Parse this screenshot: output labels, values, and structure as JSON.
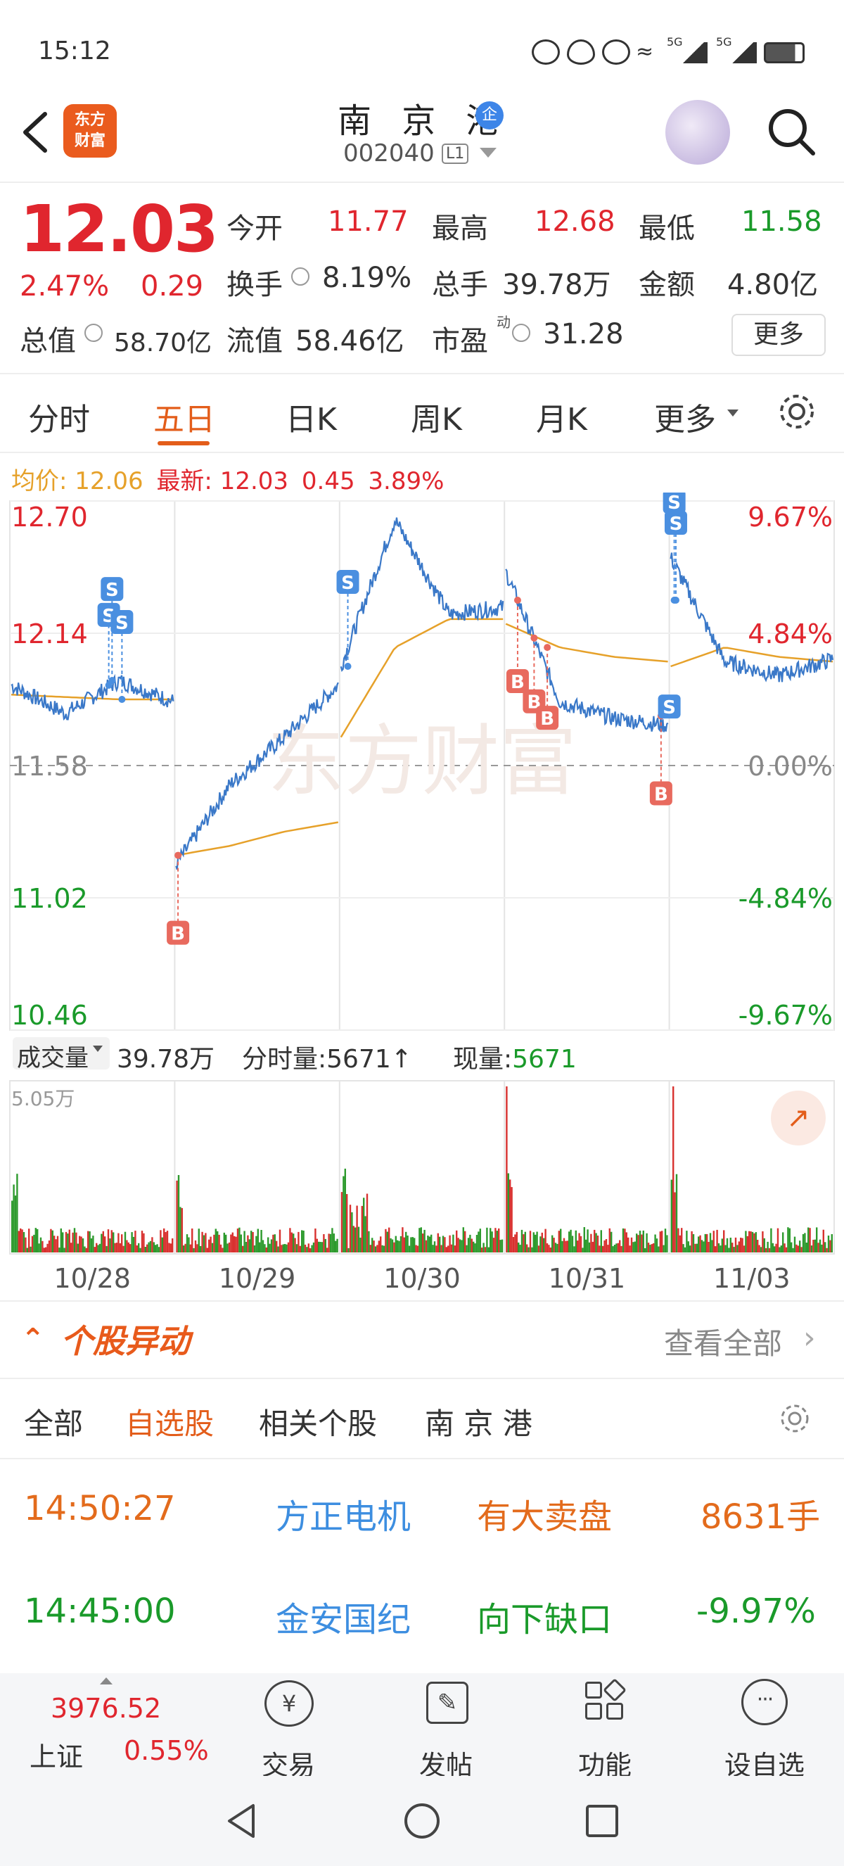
{
  "status_bar": {
    "time": "15:12",
    "signal1": "5G",
    "signal2": "5G"
  },
  "header": {
    "stock_name": "南 京 港",
    "badge": "企",
    "code": "002040",
    "level": "L1",
    "logo_line1": "东方",
    "logo_line2": "财富"
  },
  "quote": {
    "price": "12.03",
    "change_pct": "2.47%",
    "change": "0.29",
    "open_label": "今开",
    "open": "11.77",
    "high_label": "最高",
    "high": "12.68",
    "low_label": "最低",
    "low": "11.58",
    "turnover_label": "换手",
    "turnover": "8.19%",
    "volume_label": "总手",
    "volume": "39.78万",
    "amount_label": "金额",
    "amount": "4.80亿",
    "mcap_label": "总值",
    "mcap": "58.70亿",
    "float_label": "流值",
    "float": "58.46亿",
    "pe_label": "市盈",
    "pe_sup": "动",
    "pe": "31.28",
    "more": "更多"
  },
  "tabs": [
    "分时",
    "五日",
    "日K",
    "周K",
    "月K",
    "更多"
  ],
  "chart_info": {
    "avg_label": "均价:",
    "avg": "12.06",
    "latest_label": "最新:",
    "latest": "12.03",
    "chg": "0.45",
    "chg_pct": "3.89%"
  },
  "chart_data": {
    "type": "line",
    "x": [
      "10/28",
      "10/29",
      "10/30",
      "10/31",
      "11/03"
    ],
    "y_labels_left": [
      "12.70",
      "12.14",
      "11.58",
      "11.02",
      "10.46"
    ],
    "y_labels_right": [
      "9.67%",
      "4.84%",
      "0.00%",
      "-4.84%",
      "-9.67%"
    ],
    "ylim": [
      10.46,
      12.7
    ],
    "series": [
      {
        "name": "均价",
        "values_by_day": [
          [
            11.88,
            11.87,
            11.86,
            11.86
          ],
          [
            11.2,
            11.24,
            11.3,
            11.34
          ],
          [
            11.7,
            12.08,
            12.2,
            12.2
          ],
          [
            12.18,
            12.08,
            12.04,
            12.02
          ],
          [
            12.0,
            12.08,
            12.04,
            12.02
          ]
        ]
      },
      {
        "name": "最新",
        "values_by_day": [
          [
            11.92,
            11.8,
            11.94,
            11.85
          ],
          [
            11.16,
            11.5,
            11.7,
            11.92
          ],
          [
            12.0,
            12.62,
            12.22,
            12.25
          ],
          [
            12.4,
            11.85,
            11.78,
            11.75
          ],
          [
            12.46,
            12.02,
            11.96,
            12.03
          ]
        ]
      }
    ],
    "volume_label": "成交量",
    "volume_total": "39.78万",
    "minute_vol_label": "分时量:",
    "minute_vol": "5671",
    "cur_vol_label": "现量:",
    "cur_vol": "5671",
    "vol_max": "5.05万"
  },
  "stock_moves": {
    "title": "个股异动",
    "view_all": "查看全部",
    "filters": [
      "全部",
      "自选股",
      "相关个股",
      "南 京 港"
    ],
    "rows": [
      {
        "time": "14:50:27",
        "name": "方正电机",
        "event": "有大卖盘",
        "value": "8631手"
      },
      {
        "time": "14:45:00",
        "name": "金安国纪",
        "event": "向下缺口",
        "value": "-9.97%"
      }
    ]
  },
  "bottom_nav": {
    "index_value": "3976.52",
    "index_name": "上证",
    "index_pct": "0.55%",
    "items": [
      "交易",
      "发帖",
      "功能",
      "设自选"
    ]
  },
  "colors": {
    "up": "#e0262e",
    "down": "#1a9a2a",
    "accent": "#e35d1a",
    "avg_line": "#e6a12a",
    "price_line": "#3a78c8",
    "blue_text": "#3d8ee0"
  }
}
